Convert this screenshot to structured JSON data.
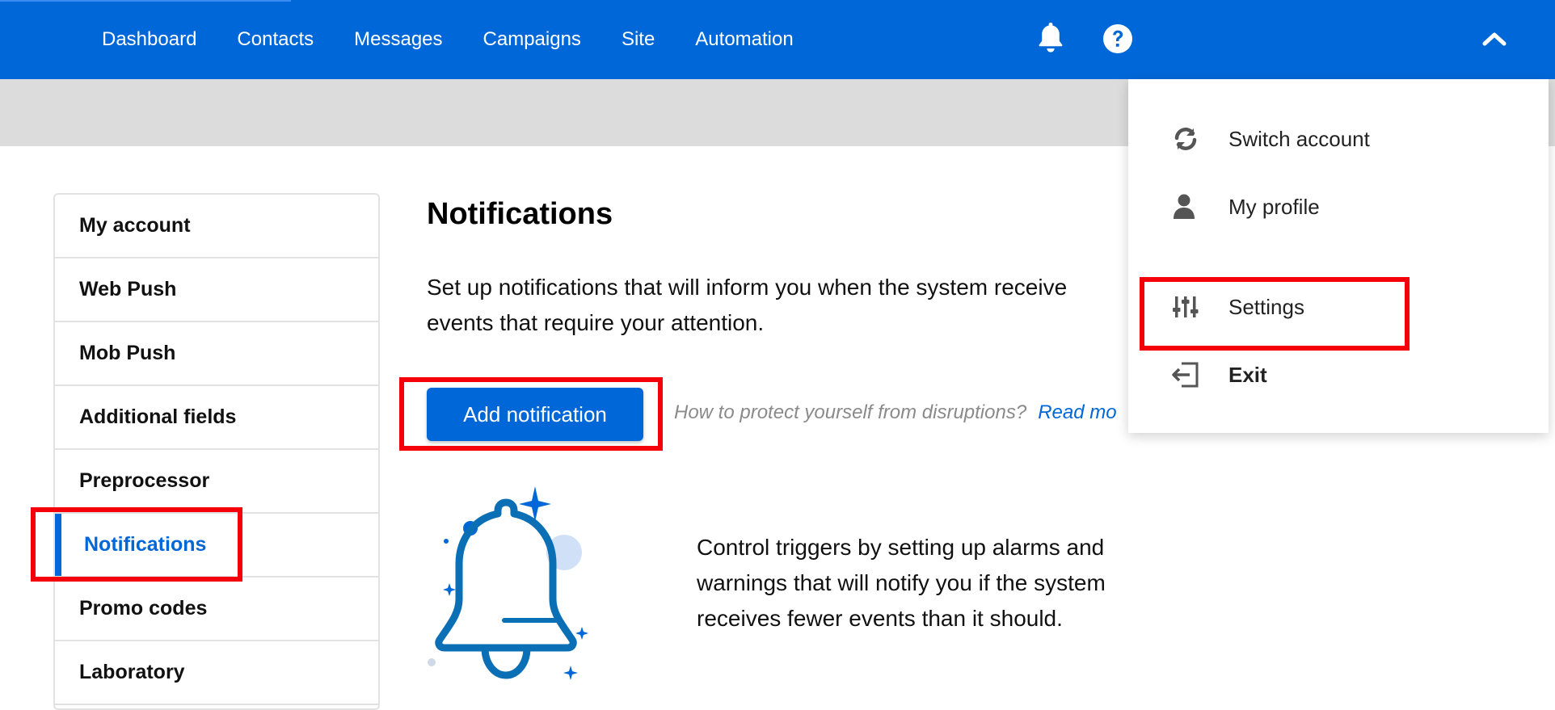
{
  "nav": {
    "items": [
      "Dashboard",
      "Contacts",
      "Messages",
      "Campaigns",
      "Site",
      "Automation"
    ]
  },
  "colors": {
    "brand": "#0067d8",
    "highlight": "#f5000a",
    "band": "#dcdcdc"
  },
  "icons": {
    "bell": "bell-icon",
    "help": "question-circle-icon",
    "chevron": "chevron-up-icon"
  },
  "sidebar": {
    "items": [
      {
        "label": "My account"
      },
      {
        "label": "Web Push"
      },
      {
        "label": "Mob Push"
      },
      {
        "label": "Additional fields"
      },
      {
        "label": "Preprocessor"
      },
      {
        "label": "Notifications",
        "active": true
      },
      {
        "label": "Promo codes"
      },
      {
        "label": "Laboratory"
      }
    ]
  },
  "main": {
    "title": "Notifications",
    "intro": "Set up notifications that will inform you when the system receive events that require your attention.",
    "add_button": "Add notification",
    "help_question": "How to protect yourself from disruptions?",
    "help_link": "Read mo",
    "control_text": "Control triggers by setting up alarms and warnings that will notify you if the system receives fewer events than it should."
  },
  "dropdown": {
    "items": [
      {
        "label": "Switch account",
        "icon": "refresh-icon"
      },
      {
        "label": "My profile",
        "icon": "user-icon"
      },
      {
        "label": "Settings",
        "icon": "sliders-icon"
      },
      {
        "label": "Exit",
        "icon": "sign-out-icon"
      }
    ]
  }
}
